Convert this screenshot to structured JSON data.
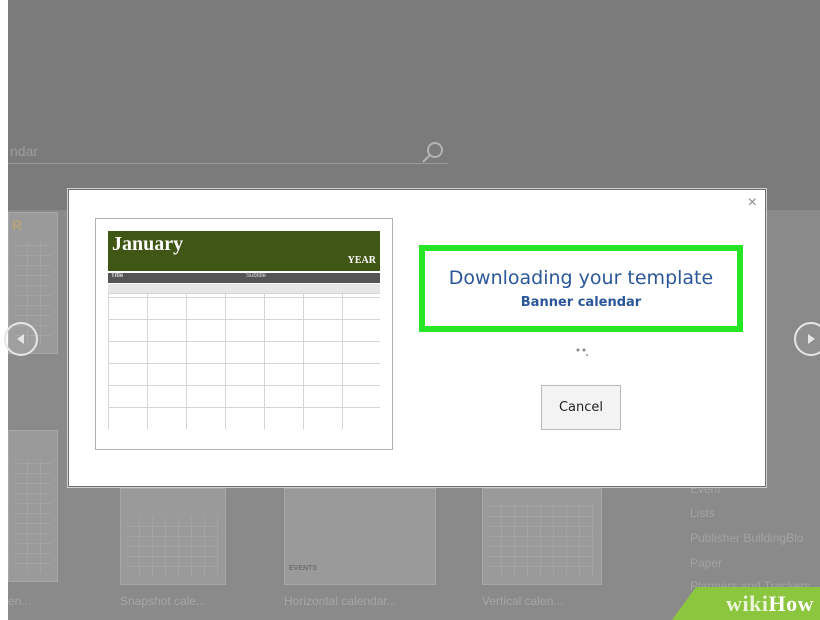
{
  "search": {
    "partial_text": "ndar"
  },
  "background_gallery": {
    "labels": [
      "en...",
      "Snapshot cale...",
      "Horizontal calendar...",
      "Vertical calen..."
    ],
    "partial_thumb_letter": "R",
    "thumb_event_text": "EVENTS"
  },
  "categories": [
    "Event",
    "Lists",
    "Publisher BuildingBlo",
    "Paper",
    "Planners and Trackers"
  ],
  "modal": {
    "close_glyph": "×",
    "preview": {
      "month": "January",
      "year": "YEAR",
      "title_label": "Title",
      "subtitle_label": "Subtitle"
    },
    "status_title": "Downloading your template",
    "status_subtitle": "Banner calendar",
    "cancel_label": "Cancel"
  },
  "watermark": {
    "wiki": "wiki",
    "how": "How"
  },
  "colors": {
    "highlight": "#26e626",
    "link_blue": "#2b579a",
    "calendar_banner": "#3f5615"
  }
}
